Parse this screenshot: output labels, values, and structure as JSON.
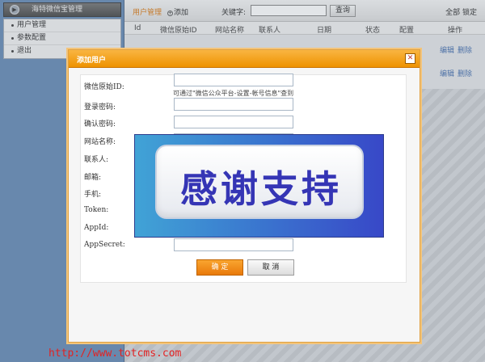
{
  "sidebar": {
    "title": "海特微信宝管理",
    "items": [
      {
        "label": "用户管理"
      },
      {
        "label": "参数配置"
      },
      {
        "label": "退出"
      }
    ]
  },
  "toolbar": {
    "tab_label": "用户管理",
    "add_label": "添加",
    "keyword_label": "关键字:",
    "keyword_value": "",
    "search_label": "查询",
    "right_labels": "全部 锁定"
  },
  "table": {
    "headers": [
      "Id",
      "微信原始ID",
      "网站名称",
      "联系人",
      "日期",
      "状态",
      "配置",
      "操作"
    ],
    "row_actions": [
      {
        "edit": "编辑",
        "delete": "删除"
      },
      {
        "edit": "编辑",
        "delete": "删除"
      }
    ]
  },
  "dialog": {
    "title": "添加用户",
    "hint": "可通过\"微信公众平台-设置-帐号信息\"查到",
    "fields": [
      {
        "label": "微信原始ID:",
        "value": ""
      },
      {
        "label": "登录密码:",
        "value": ""
      },
      {
        "label": "确认密码:",
        "value": ""
      },
      {
        "label": "网站名称:",
        "value": ""
      },
      {
        "label": "联系人:",
        "value": ""
      },
      {
        "label": "邮箱:",
        "value": ""
      },
      {
        "label": "手机:",
        "value": ""
      },
      {
        "label": "Token:",
        "value": ""
      },
      {
        "label": "AppId:",
        "value": ""
      },
      {
        "label": "AppSecret:",
        "value": ""
      }
    ],
    "ok_label": "确 定",
    "cancel_label": "取 消"
  },
  "banner": {
    "text": "感谢支持"
  },
  "watermark": "http://www.totcms.com",
  "colors": {
    "accent": "#ee9200",
    "sidebar": "#5d83b1",
    "banner": "#3848c8",
    "watermark": "#e32222"
  }
}
